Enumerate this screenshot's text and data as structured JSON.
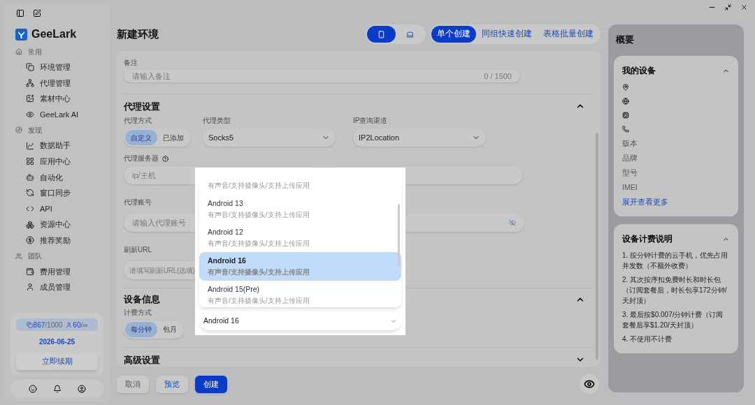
{
  "sidebar": {
    "brand": "GeeLark",
    "sections": [
      {
        "label": "常用",
        "items": [
          {
            "label": "环境管理"
          },
          {
            "label": "代理管理"
          },
          {
            "label": "素材中心"
          },
          {
            "label": "GeeLark AI"
          }
        ]
      },
      {
        "label": "发现",
        "items": [
          {
            "label": "数据助手"
          },
          {
            "label": "应用中心"
          },
          {
            "label": "自动化"
          },
          {
            "label": "窗口同步"
          },
          {
            "label": "API"
          },
          {
            "label": "资源中心"
          },
          {
            "label": "推荐奖励"
          }
        ]
      },
      {
        "label": "团队",
        "items": [
          {
            "label": "费用管理"
          },
          {
            "label": "成员管理"
          }
        ]
      }
    ],
    "usage": {
      "devices": "867",
      "device_limit": "/1000",
      "members": "60",
      "member_limit": "/∞"
    },
    "date": "2026-06-25",
    "renew_button": "立即续期"
  },
  "header": {
    "title": "新建环境",
    "device_types": [
      {
        "selected": true
      },
      {
        "selected": false
      }
    ],
    "create_modes": [
      {
        "label": "单个创建",
        "selected": true
      },
      {
        "label": "同组快速创建",
        "selected": false
      },
      {
        "label": "表格批量创建",
        "selected": false
      }
    ]
  },
  "form": {
    "remark": {
      "label": "备注",
      "placeholder": "请输入备注",
      "counter": "0 / 1500"
    },
    "proxy": {
      "title": "代理设置",
      "expanded": true,
      "method": {
        "label": "代理方式",
        "options": [
          {
            "label": "自定义",
            "selected": true
          },
          {
            "label": "已添加",
            "selected": false
          }
        ]
      },
      "type": {
        "label": "代理类型",
        "value": "Socks5"
      },
      "ip_channel": {
        "label": "IP查询渠道",
        "value": "IP2Location"
      },
      "server": {
        "label": "代理服务器",
        "placeholder": "ip/主机"
      },
      "account": {
        "label": "代理账号",
        "placeholder": "请输入代理账号"
      },
      "refresh_url": {
        "label": "刷新URL",
        "placeholder": "请填写刷新URL(选填)"
      }
    },
    "device": {
      "title": "设备信息",
      "expanded": true,
      "billing": {
        "label": "计费方式",
        "options": [
          {
            "label": "每分钟",
            "selected": true
          },
          {
            "label": "包月",
            "selected": false
          }
        ]
      }
    },
    "advanced": {
      "title": "高级设置",
      "expanded": false
    }
  },
  "footer_buttons": [
    {
      "label": "取消",
      "kind": "plain"
    },
    {
      "label": "预览",
      "kind": "link"
    },
    {
      "label": "创建",
      "kind": "primary"
    }
  ],
  "os_dropdown": {
    "value": "Android 16",
    "options": [
      {
        "subtitle": "有声音/支持摄像头/支持上传应用",
        "selected": false
      },
      {
        "title": "Android 13",
        "subtitle": "有声音/支持摄像头/支持上传应用",
        "selected": false
      },
      {
        "title": "Android 12",
        "subtitle": "有声音/支持摄像头/支持上传应用",
        "selected": false
      },
      {
        "title": "Android 16",
        "subtitle": "有声音/支持摄像头/支持上传应用",
        "selected": true
      },
      {
        "title": "Android 15(Pre)",
        "subtitle": "有声音/支持摄像头/支持上传应用",
        "selected": false
      }
    ]
  },
  "summary": {
    "title": "概要",
    "my_devices": {
      "title": "我的设备",
      "expanded": true,
      "fields": [
        "版本",
        "品牌",
        "型号",
        "IMEI"
      ],
      "more_link": "展开查看更多"
    },
    "billing_notes": {
      "title": "设备计费说明",
      "expanded": true,
      "notes": [
        "1. 按分钟计费的云手机，优先占用并发数（不额外收费）",
        "2. 其次按序扣免费时长和时长包（订阅套餐后，时长包享172分钟/天封顶）",
        "3. 最后按$0.007/分钟计费（订阅套餐后享$1.20/天封顶）",
        "4. 不使用不计费"
      ]
    }
  }
}
